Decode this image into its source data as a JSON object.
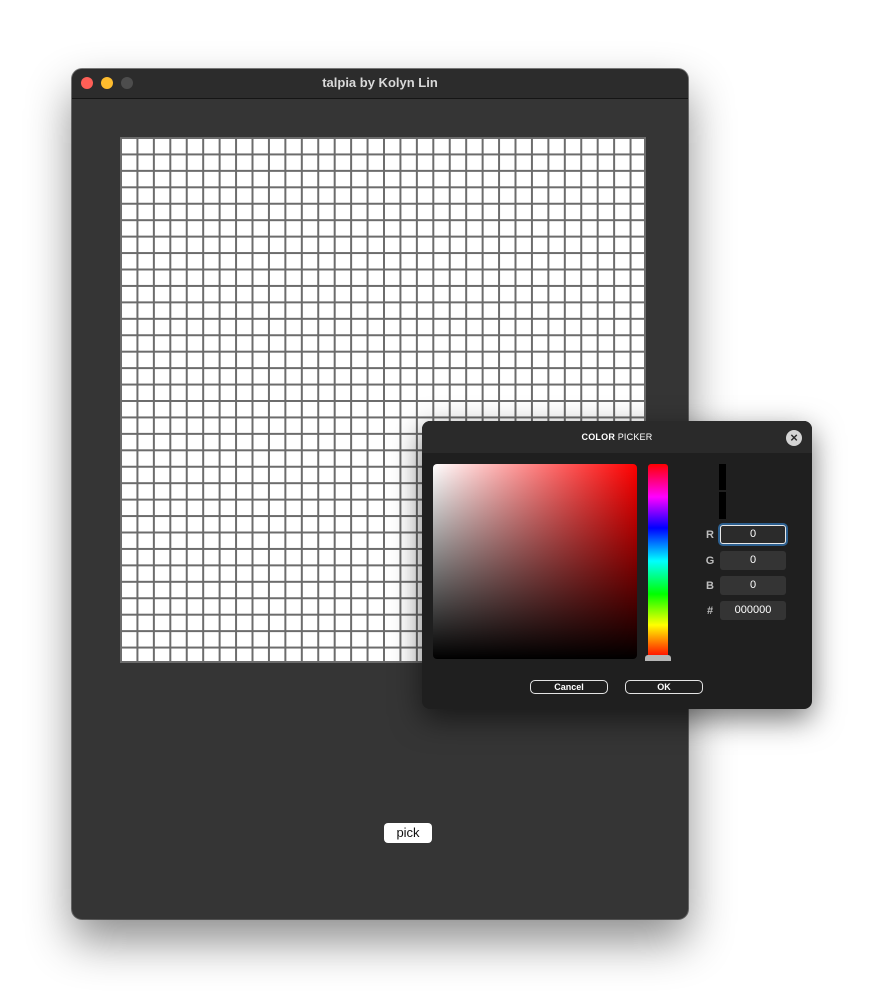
{
  "window": {
    "title": "talpia by Kolyn Lin",
    "grid": {
      "columns": 32,
      "rows": 32,
      "cell_color": "#ffffff",
      "line_color": "#6c6c6c"
    },
    "pick_label": "pick"
  },
  "color_picker": {
    "title_bold": "COLOR",
    "title_rest": " PICKER",
    "close_icon": "close-circle-icon",
    "hue": "#ff0000",
    "fields": [
      {
        "label": "R",
        "value": "0"
      },
      {
        "label": "G",
        "value": "0"
      },
      {
        "label": "B",
        "value": "0"
      },
      {
        "label": "#",
        "value": "000000"
      }
    ],
    "cancel_label": "Cancel",
    "ok_label": "OK",
    "selected_color": "#000000"
  }
}
